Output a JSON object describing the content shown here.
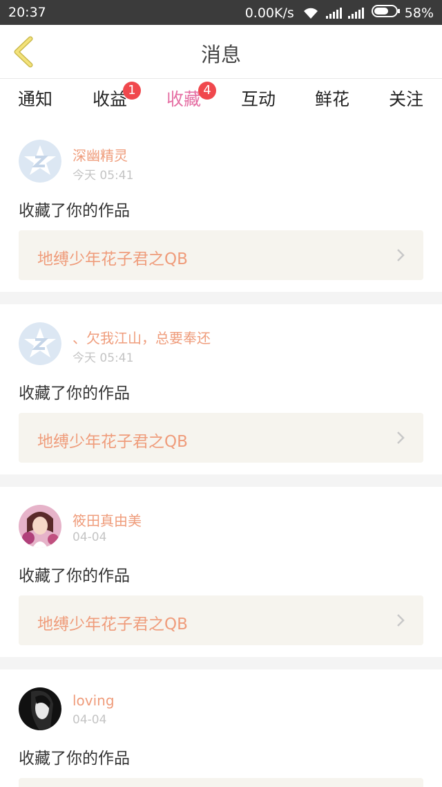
{
  "status_bar": {
    "time": "20:37",
    "network_speed": "0.00K/s",
    "battery": "58%"
  },
  "header": {
    "title": "消息"
  },
  "tabs": [
    {
      "label": "通知"
    },
    {
      "label": "收益",
      "badge": "1"
    },
    {
      "label": "收藏",
      "badge": "4",
      "active": true
    },
    {
      "label": "互动"
    },
    {
      "label": "鲜花"
    },
    {
      "label": "关注"
    }
  ],
  "messages": [
    {
      "user": "深幽精灵",
      "time": "今天 05:41",
      "action": "收藏了你的作品",
      "work": "地缚少年花子君之QB",
      "avatar": "default-qq-icon"
    },
    {
      "user": "、欠我江山，总要奉还",
      "time": "今天 05:41",
      "action": "收藏了你的作品",
      "work": "地缚少年花子君之QB",
      "avatar": "default-qq-icon"
    },
    {
      "user": "筱田真由美",
      "time": "04-04",
      "action": "收藏了你的作品",
      "work": "地缚少年花子君之QB",
      "avatar": "anime-girl-avatar"
    },
    {
      "user": "loving",
      "time": "04-04",
      "action": "收藏了你的作品",
      "work": "",
      "avatar": "bw-portrait-avatar"
    }
  ],
  "colors": {
    "accent": "#e56ea3",
    "username": "#ef9c7b",
    "badge": "#f0484d",
    "back_arrow": "#e8d66a"
  }
}
